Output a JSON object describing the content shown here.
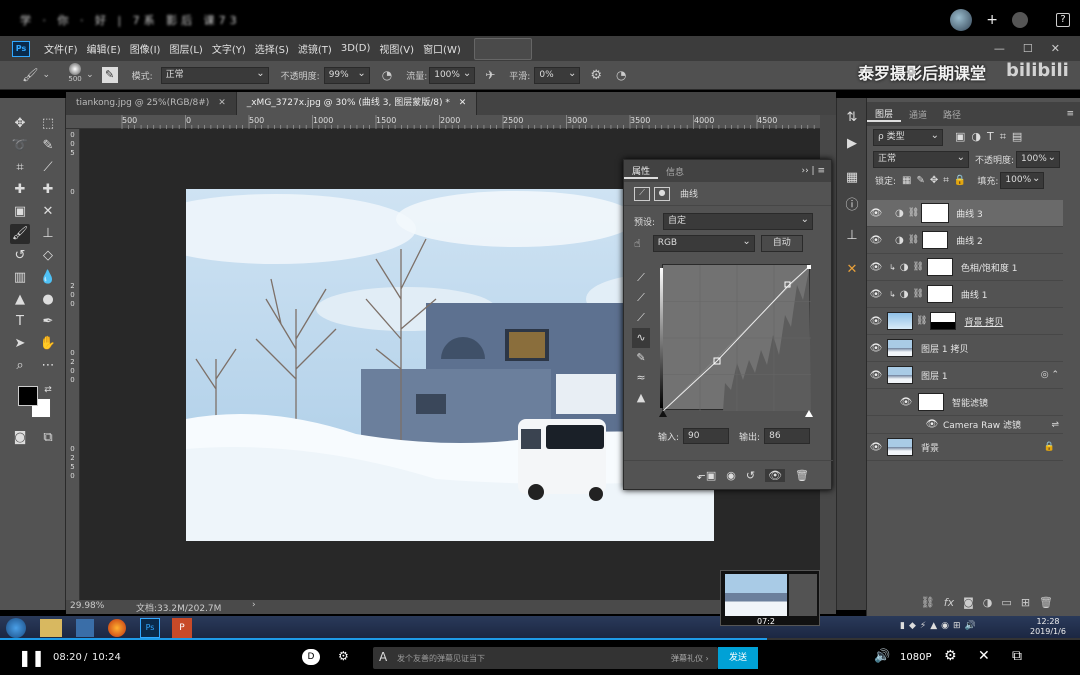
{
  "video_top": {
    "title_blurred": "学 · 你 · 好 | 7系 影后 课73"
  },
  "ps": {
    "logo": "Ps",
    "menu": [
      "文件(F)",
      "编辑(E)",
      "图像(I)",
      "图层(L)",
      "文字(Y)",
      "选择(S)",
      "滤镜(T)",
      "3D(D)",
      "视图(V)",
      "窗口(W)"
    ],
    "window_controls": [
      "—",
      "☐",
      "✕"
    ],
    "options": {
      "brush_size": "500",
      "mode_label": "模式:",
      "mode_value": "正常",
      "opacity_label": "不透明度:",
      "opacity_value": "99%",
      "flow_label": "流量:",
      "flow_value": "100%",
      "smooth_label": "平滑:",
      "smooth_value": "0%"
    },
    "watermark": "泰罗摄影后期课堂",
    "bili_logo": "bilibili",
    "tabs": [
      {
        "label": "tiankong.jpg @ 25%(RGB/8#)",
        "close": "✕"
      },
      {
        "label": "_xMG_3727x.jpg @ 30% (曲线 3, 图层蒙版/8) *",
        "close": "✕"
      }
    ],
    "ruler_labels": [
      "500",
      "0",
      "500",
      "1000",
      "1500",
      "2000",
      "2500",
      "3000",
      "3500",
      "4000",
      "4500"
    ],
    "vruler_labels": [
      "0",
      "0",
      "5",
      "0",
      "0",
      "2",
      "0",
      "0",
      "0",
      "5",
      "0",
      "0",
      "2",
      "0",
      "0",
      "0",
      "2",
      "5",
      "0",
      "0",
      "3",
      "0",
      "0",
      "0"
    ],
    "status": {
      "zoom": "29.98%",
      "doc": "文档:33.2M/202.7M",
      "arrow": "›"
    },
    "properties": {
      "tab1": "属性",
      "tab2": "信息",
      "panel_title": "曲线",
      "preset_label": "预设:",
      "preset_value": "自定",
      "channel_value": "RGB",
      "auto_button": "自动",
      "input_label": "输入:",
      "input_value": "90",
      "output_label": "输出:",
      "output_value": "86"
    },
    "layers_panel": {
      "tabs": [
        "图层",
        "通道",
        "路径"
      ],
      "filter_label": "ρ 类型",
      "blend_mode": "正常",
      "opacity_label": "不透明度:",
      "opacity_value": "100%",
      "lock_label": "锁定:",
      "fill_label": "填充:",
      "fill_value": "100%",
      "layers": [
        {
          "name": "曲线 3",
          "type": "adjust",
          "selected": true
        },
        {
          "name": "曲线 2",
          "type": "adjust"
        },
        {
          "name": "色相/饱和度 1",
          "type": "adjust-clip"
        },
        {
          "name": "曲线 1",
          "type": "adjust-clip"
        },
        {
          "name": "背景 拷贝",
          "type": "image-mask"
        },
        {
          "name": "图层 1 拷贝",
          "type": "image"
        },
        {
          "name": "图层 1",
          "type": "smart"
        },
        {
          "name": "智能滤镜",
          "type": "filter-mask"
        },
        {
          "name": "Camera Raw 滤镜",
          "type": "filter"
        },
        {
          "name": "背景",
          "type": "bg"
        }
      ]
    }
  },
  "taskbar": {
    "time": "12:28",
    "date": "2019/1/6"
  },
  "player": {
    "current": "08:20",
    "total": "10:24",
    "sep": "/",
    "danmaku_placeholder": "发个友善的弹幕见证当下",
    "etiquette": "弹幕礼仪 ›",
    "send": "发送",
    "quality": "1080P",
    "preview_time": "07:2"
  },
  "colors": {
    "accent_blue": "#1e9be8",
    "send_blue": "#00a1d6",
    "ps_dark": "#535353"
  }
}
